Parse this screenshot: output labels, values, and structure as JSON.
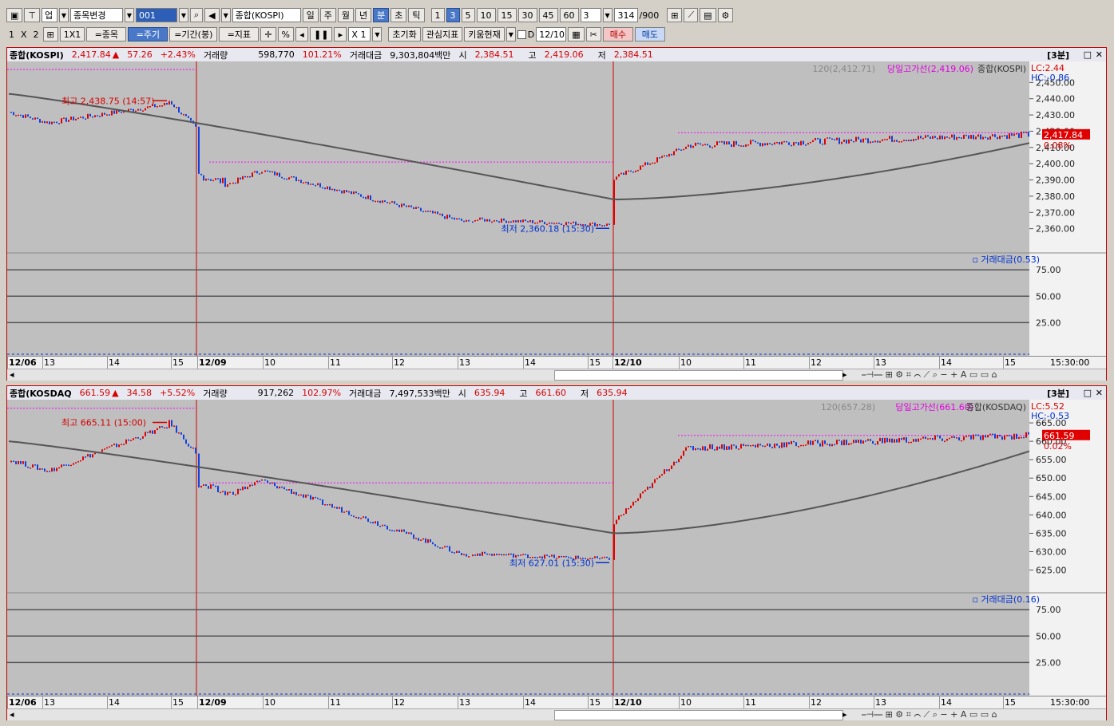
{
  "toolbar1": {
    "market_type": "업",
    "item_change": "종목변경",
    "code": "001",
    "item_name": "종합(KOSPI)",
    "periods": [
      "일",
      "주",
      "월",
      "년",
      "분",
      "초",
      "틱"
    ],
    "intervals": [
      "1",
      "3",
      "5",
      "10",
      "15",
      "30",
      "45",
      "60"
    ],
    "interval_select": "3",
    "count": "314",
    "count_max": "/900"
  },
  "toolbar2": {
    "layout": [
      "1",
      "X",
      "2"
    ],
    "grid_1x1": "1X1",
    "eq_item": "=종목",
    "eq_period": "=주기",
    "eq_range": "=기간(봉)",
    "eq_indicator": "=지표",
    "percent": "%",
    "zoom": "X 1",
    "reset": "초기화",
    "watch_indicator": "관심지표",
    "kiwoom_now": "키움현재",
    "d_label": "D",
    "date_value": "12/10",
    "buy": "매수",
    "sell": "매도"
  },
  "panels": [
    {
      "name": "종합(KOSPI)",
      "price": "2,417.84",
      "arrow": "▲",
      "change": "57.26",
      "change_pct": "+2.43%",
      "volume_label": "거래량",
      "volume": "598,770",
      "volume_pct": "101.21%",
      "amount_label": "거래대금",
      "amount": "9,303,804백만",
      "open_label": "시",
      "open": "2,384.51",
      "high_label": "고",
      "high": "2,419.06",
      "low_label": "저",
      "low": "2,384.51",
      "interval_tag": "[3분]",
      "legend_ma": "120(2,412.71)",
      "legend_hi": "당일고가선(2,419.06)",
      "legend_name": "종합(KOSPI)",
      "lc": "LC:2.44",
      "hc": "HC:-0.86",
      "hi_ann": "최고 2,438.75 (14:57)",
      "lo_ann": "최저 2,360.18 (15:30)",
      "price_ticks": [
        "2,450.00",
        "2,440.00",
        "2,430.00",
        "2,420.00",
        "2,410.00",
        "2,400.00",
        "2,390.00",
        "2,380.00",
        "2,370.00",
        "2,360.00"
      ],
      "cur_price_tag": "2,417.84",
      "cur_pct_tag": "0.08%",
      "sub_legend": "거래대금(0.53)",
      "sub_ticks": [
        "75.00",
        "50.00",
        "25.00"
      ],
      "dates": [
        "12/06",
        "13",
        "14",
        "15",
        "12/09",
        "10",
        "11",
        "12",
        "13",
        "14",
        "15",
        "12/10",
        "10",
        "11",
        "12",
        "13",
        "14",
        "15"
      ],
      "time_label": "15:30:00",
      "accent": "#d60000"
    },
    {
      "name": "종합(KOSDAQ",
      "price": "661.59",
      "arrow": "▲",
      "change": "34.58",
      "change_pct": "+5.52%",
      "volume_label": "거래량",
      "volume": "917,262",
      "volume_pct": "102.97%",
      "amount_label": "거래대금",
      "amount": "7,497,533백만",
      "open_label": "시",
      "open": "635.94",
      "high_label": "고",
      "high": "661.60",
      "low_label": "저",
      "low": "635.94",
      "interval_tag": "[3분]",
      "legend_ma": "120(657.28)",
      "legend_hi": "당일고가선(661.60)",
      "legend_name": "종합(KOSDAQ)",
      "lc": "LC:5.52",
      "hc": "HC:-0.53",
      "hi_ann": "최고 665.11 (15:00)",
      "lo_ann": "최저 627.01 (15:30)",
      "price_ticks": [
        "665.00",
        "660.00",
        "655.00",
        "650.00",
        "645.00",
        "640.00",
        "635.00",
        "630.00",
        "625.00"
      ],
      "cur_price_tag": "661.59",
      "cur_pct_tag": "0.02%",
      "sub_legend": "거래대금(0.16)",
      "sub_ticks": [
        "75.00",
        "50.00",
        "25.00"
      ],
      "dates": [
        "12/06",
        "13",
        "14",
        "15",
        "12/09",
        "10",
        "11",
        "12",
        "13",
        "14",
        "15",
        "12/10",
        "10",
        "11",
        "12",
        "13",
        "14",
        "15"
      ],
      "time_label": "15:30:00",
      "accent": "#d60000"
    }
  ]
}
